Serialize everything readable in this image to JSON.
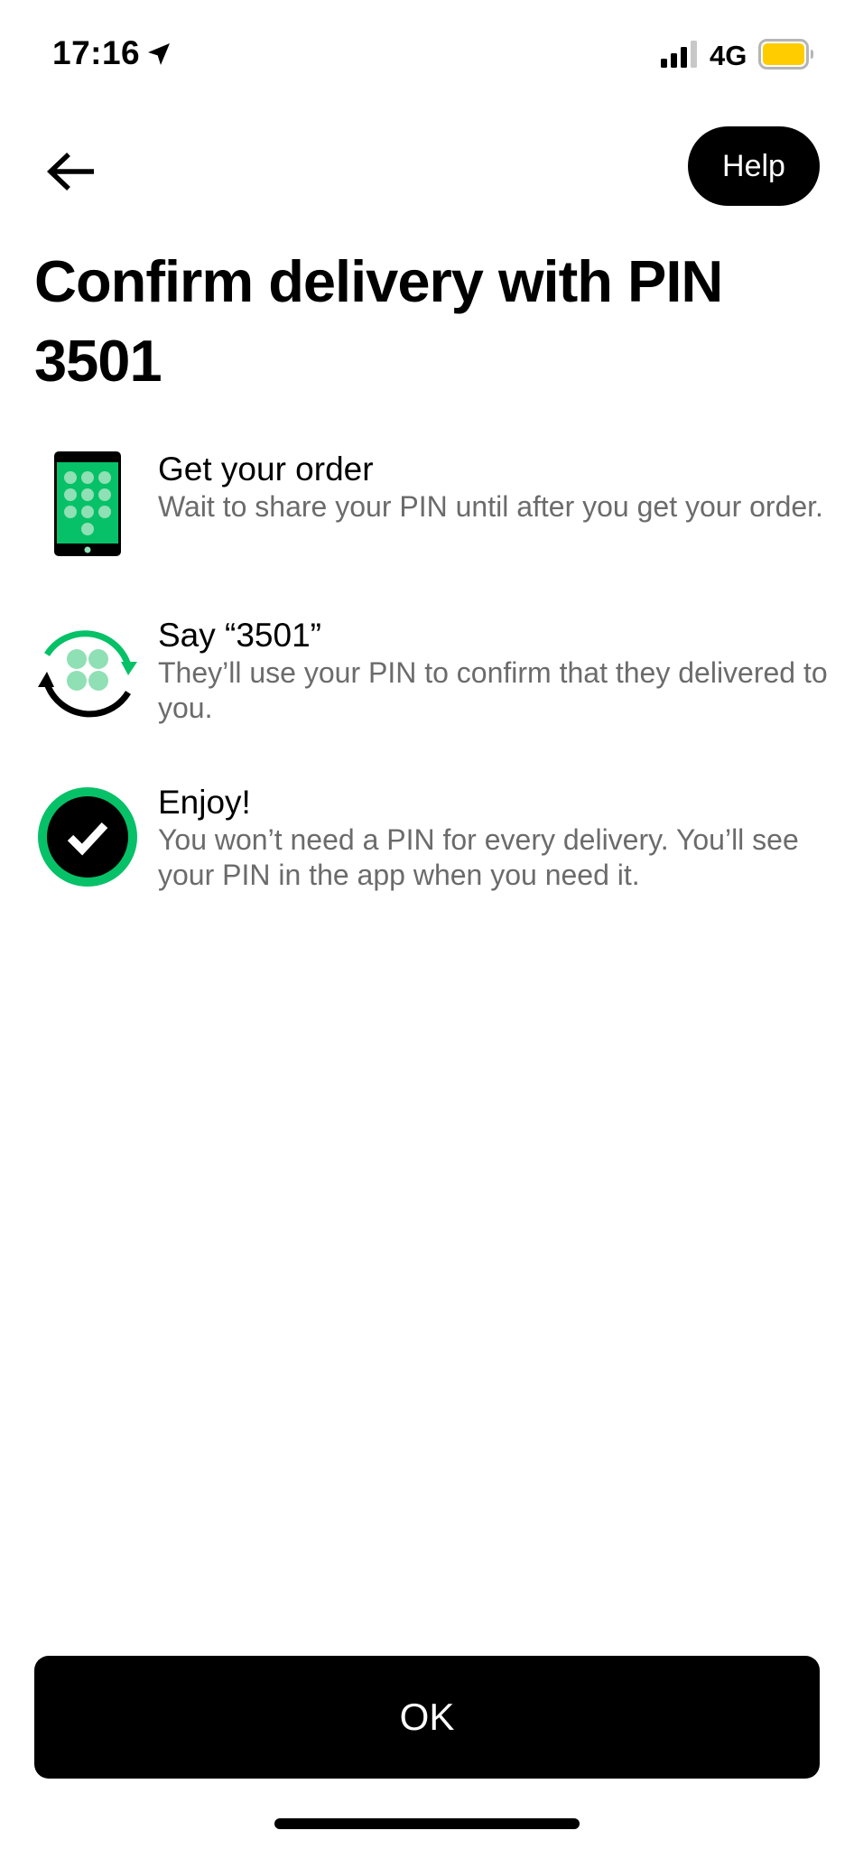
{
  "status_bar": {
    "time": "17:16",
    "network": "4G",
    "location_icon": "location-arrow-icon",
    "signal_icon": "signal-bars-icon",
    "battery_icon": "battery-icon",
    "battery_color": "#ffcc00"
  },
  "header": {
    "back_icon": "arrow-left-icon",
    "help_label": "Help"
  },
  "title": "Confirm delivery with PIN 3501",
  "steps": [
    {
      "title": "Get your order",
      "description": "Wait to share your PIN until after you get your order.",
      "icon": "phone-keypad-icon"
    },
    {
      "title": "Say “3501”",
      "description": "They’ll use your PIN to confirm that they delivered to you.",
      "icon": "pin-exchange-icon"
    },
    {
      "title": "Enjoy!",
      "description": "You won’t need a PIN for every delivery. You’ll see your PIN in the app when you need it.",
      "icon": "checkmark-circle-icon"
    }
  ],
  "ok_label": "OK",
  "colors": {
    "accent_green": "#06c167",
    "light_green": "#8fe0b4",
    "muted_text": "#6b6b6b"
  }
}
